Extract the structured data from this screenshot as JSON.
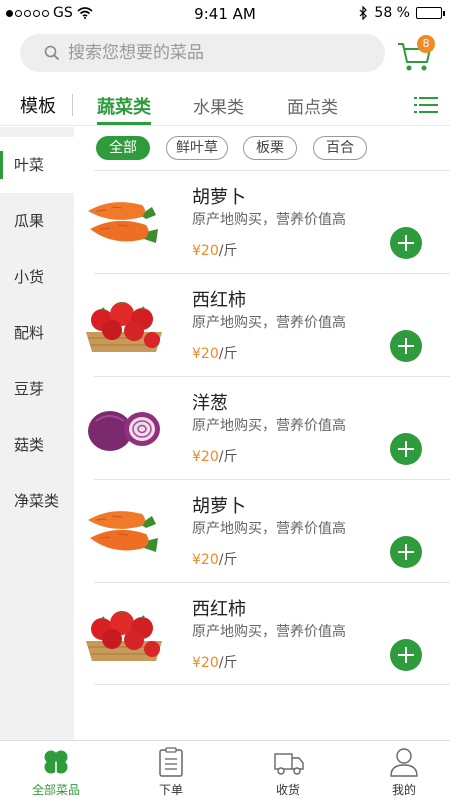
{
  "status_bar": {
    "carrier": "GS",
    "time": "9:41 AM",
    "battery": "58 %",
    "battery_level": 0.58
  },
  "search": {
    "placeholder": "搜索您想要的菜品"
  },
  "cart": {
    "badge": "8"
  },
  "category_bar": {
    "template_label": "模板",
    "tabs": [
      {
        "label": "蔬菜类",
        "active": true
      },
      {
        "label": "水果类",
        "active": false
      },
      {
        "label": "面点类",
        "active": false
      }
    ]
  },
  "sidebar": {
    "items": [
      {
        "label": "叶菜",
        "active": true
      },
      {
        "label": "瓜果"
      },
      {
        "label": "小货"
      },
      {
        "label": "配料"
      },
      {
        "label": "豆芽"
      },
      {
        "label": "菇类"
      },
      {
        "label": "净菜类"
      }
    ]
  },
  "filters": [
    {
      "label": "全部",
      "active": true
    },
    {
      "label": "鲜叶草"
    },
    {
      "label": "板栗"
    },
    {
      "label": "百合"
    }
  ],
  "products": [
    {
      "name": "胡萝卜",
      "desc": "原产地购买，营养价值高",
      "price": "¥20",
      "unit": "/斤",
      "image": "carrot"
    },
    {
      "name": "西红柿",
      "desc": "原产地购买，营养价值高",
      "price": "¥20",
      "unit": "/斤",
      "image": "tomato"
    },
    {
      "name": "洋葱",
      "desc": "原产地购买，营养价值高",
      "price": "¥20",
      "unit": "/斤",
      "image": "onion"
    },
    {
      "name": "胡萝卜",
      "desc": "原产地购买，营养价值高",
      "price": "¥20",
      "unit": "/斤",
      "image": "carrot"
    },
    {
      "name": "西红柿",
      "desc": "原产地购买，营养价值高",
      "price": "¥20",
      "unit": "/斤",
      "image": "tomato"
    }
  ],
  "bottom_nav": [
    {
      "label": "全部菜品",
      "icon": "clover-icon",
      "active": true
    },
    {
      "label": "下单",
      "icon": "clipboard-icon"
    },
    {
      "label": "收货",
      "icon": "truck-icon"
    },
    {
      "label": "我的",
      "icon": "user-icon"
    }
  ],
  "colors": {
    "accent": "#2e9b3c",
    "price": "#f08a24",
    "badge": "#f08a24"
  }
}
